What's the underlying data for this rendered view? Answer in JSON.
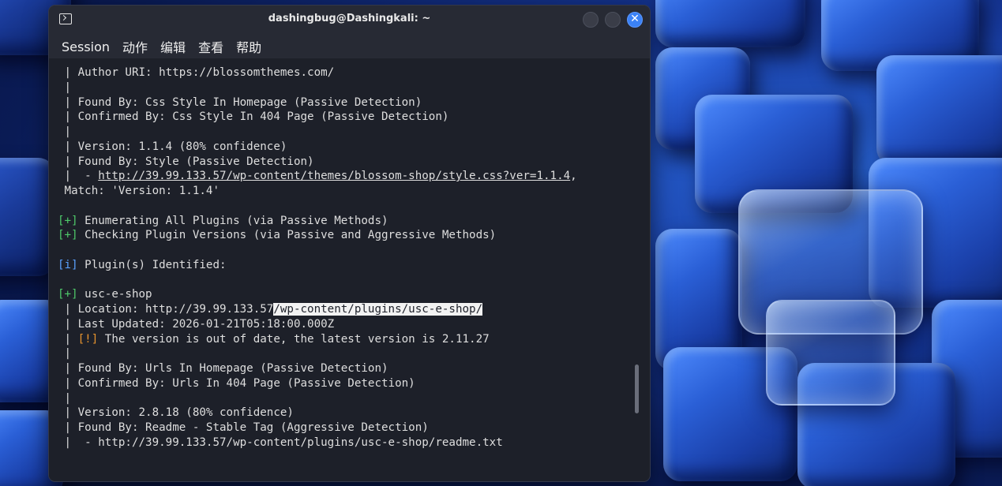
{
  "window": {
    "title": "dashingbug@Dashingkali: ~"
  },
  "menu": [
    "Session",
    "动作",
    "编辑",
    "查看",
    "帮助"
  ],
  "terminal": {
    "lines": [
      " | Author URI: https://blossomthemes.com/",
      " |",
      " | Found By: Css Style In Homepage (Passive Detection)",
      " | Confirmed By: Css Style In 404 Page (Passive Detection)",
      " |",
      " | Version: 1.1.4 (80% confidence)",
      " | Found By: Style (Passive Detection)",
      " |  - ",
      " Match: 'Version: 1.1.4'",
      "",
      "",
      "",
      "",
      "",
      "",
      "",
      " | Location: http://39.99.133.57",
      " | Last Updated: 2026-01-21T05:18:00.000Z",
      " | ",
      " |",
      " | Found By: Urls In Homepage (Passive Detection)",
      " | Confirmed By: Urls In 404 Page (Passive Detection)",
      " |",
      " | Version: 2.8.18 (80% confidence)",
      " | Found By: Readme - Stable Tag (Aggressive Detection)",
      " |  - http://39.99.133.57/wp-content/plugins/usc-e-shop/readme.txt"
    ],
    "style_link": "http://39.99.133.57/wp-content/themes/blossom-shop/style.css?ver=1.1.4",
    "style_link_suffix": ",",
    "enum_plugins_tag": "[+]",
    "enum_plugins_text": " Enumerating All Plugins (via Passive Methods)",
    "check_versions_tag": "[+]",
    "check_versions_text": " Checking Plugin Versions (via Passive and Aggressive Methods)",
    "identified_tag": "[i]",
    "identified_text": " Plugin(s) Identified:",
    "plugin_tag": "[+]",
    "plugin_name": " usc-e-shop",
    "location_selected": "/wp-content/plugins/usc-e-shop/",
    "warning_tag": "[!]",
    "warning_text": " The version is out of date, the latest version is 2.11.27"
  }
}
